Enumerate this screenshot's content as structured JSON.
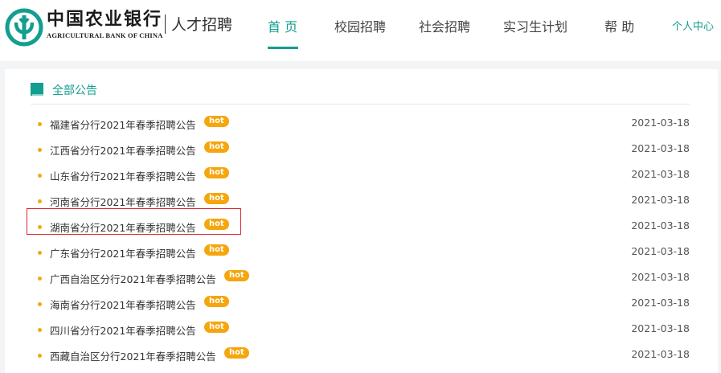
{
  "header": {
    "brand_cn": "中国农业银行",
    "brand_en": "AGRICULTURAL BANK OF CHINA",
    "brand_sub": "人才招聘",
    "accent_color": "#139e8f",
    "nav": [
      {
        "label": "首 页",
        "active": true
      },
      {
        "label": "校园招聘",
        "active": false
      },
      {
        "label": "社会招聘",
        "active": false
      },
      {
        "label": "实习生计划",
        "active": false
      },
      {
        "label": "帮 助",
        "active": false
      }
    ],
    "user_center": "个人中心"
  },
  "section": {
    "title": "全部公告",
    "icon": "square-icon"
  },
  "announcements": [
    {
      "title": "福建省分行2021年春季招聘公告",
      "badge": "hot",
      "date": "2021-03-18"
    },
    {
      "title": "江西省分行2021年春季招聘公告",
      "badge": "hot",
      "date": "2021-03-18"
    },
    {
      "title": "山东省分行2021年春季招聘公告",
      "badge": "hot",
      "date": "2021-03-18"
    },
    {
      "title": "河南省分行2021年春季招聘公告",
      "badge": "hot",
      "date": "2021-03-18"
    },
    {
      "title": "湖南省分行2021年春季招聘公告",
      "badge": "hot",
      "date": "2021-03-18"
    },
    {
      "title": "广东省分行2021年春季招聘公告",
      "badge": "hot",
      "date": "2021-03-18"
    },
    {
      "title": "广西自治区分行2021年春季招聘公告",
      "badge": "hot",
      "date": "2021-03-18"
    },
    {
      "title": "海南省分行2021年春季招聘公告",
      "badge": "hot",
      "date": "2021-03-18"
    },
    {
      "title": "四川省分行2021年春季招聘公告",
      "badge": "hot",
      "date": "2021-03-18"
    },
    {
      "title": "西藏自治区分行2021年春季招聘公告",
      "badge": "hot",
      "date": "2021-03-18"
    }
  ]
}
